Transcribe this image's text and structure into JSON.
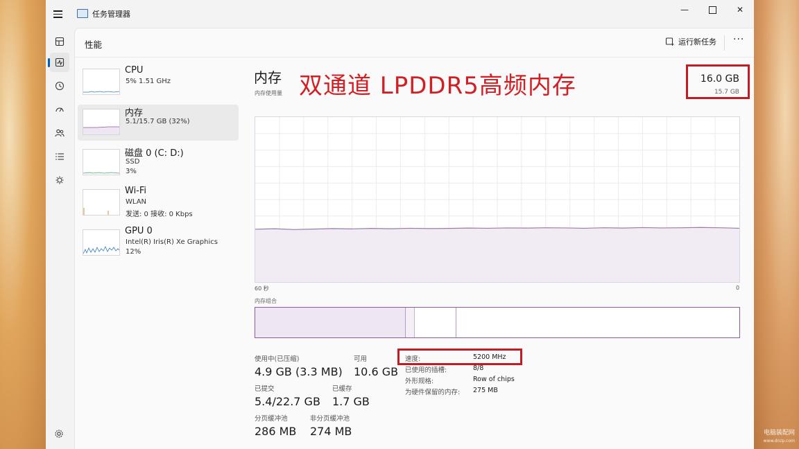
{
  "window": {
    "title": "任务管理器"
  },
  "header": {
    "title": "性能",
    "run_task_label": "运行新任务",
    "more_label": "···"
  },
  "nav": {
    "items": [
      "processes-icon",
      "performance-icon",
      "app-history-icon",
      "startup-apps-icon",
      "users-icon",
      "details-icon",
      "services-icon"
    ],
    "settings": "settings-icon"
  },
  "perf_list": [
    {
      "name": "CPU",
      "line1": "5%  1.51 GHz",
      "line2": ""
    },
    {
      "name": "内存",
      "line1": "5.1/15.7 GB (32%)",
      "line2": ""
    },
    {
      "name": "磁盘 0 (C: D:)",
      "line1": "SSD",
      "line2": "3%"
    },
    {
      "name": "Wi-Fi",
      "line1": "WLAN",
      "line2": "发送: 0  接收: 0 Kbps"
    },
    {
      "name": "GPU 0",
      "line1": "Intel(R) Iris(R) Xe Graphics",
      "line2": "12%"
    }
  ],
  "memory": {
    "title": "内存",
    "usage_label": "内存使用量",
    "overlay_text": "双通道  LPDDR5高频内存",
    "total": "16.0 GB",
    "usable": "15.7 GB",
    "axis_left": "60 秒",
    "axis_right": "0",
    "composition_label": "内存组合",
    "composition_fractions": {
      "in_use": 0.31,
      "modified": 0.017,
      "standby": 0.085
    },
    "usage_percent": 32,
    "stats": {
      "in_use_label": "使用中(已压缩)",
      "in_use_value": "4.9 GB (3.3 MB)",
      "available_label": "可用",
      "available_value": "10.6 GB",
      "committed_label": "已提交",
      "committed_value": "5.4/22.7 GB",
      "cached_label": "已缓存",
      "cached_value": "1.7 GB",
      "paged_label": "分页缓冲池",
      "paged_value": "286 MB",
      "nonpaged_label": "非分页缓冲池",
      "nonpaged_value": "274 MB"
    },
    "specs": {
      "speed_label": "速度:",
      "speed_value": "5200 MHz",
      "slots_label": "已使用的插槽:",
      "slots_value": "8/8",
      "form_label": "外形规格:",
      "form_value": "Row of chips",
      "reserved_label": "为硬件保留的内存:",
      "reserved_value": "275 MB"
    }
  },
  "watermark": {
    "line1": "电脑装配网",
    "line2": "www.dnzp.com"
  },
  "colors": {
    "accent": "#005fb8",
    "memory_purple": "#8a5a9c",
    "highlight_red": "#c41a22",
    "overlay_red": "#d21f24"
  }
}
